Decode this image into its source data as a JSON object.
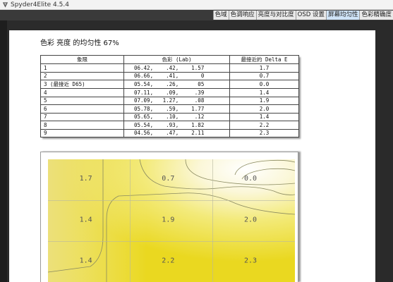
{
  "window": {
    "title": "Spyder4Elite 4.5.4"
  },
  "tabs": [
    {
      "label": "色域",
      "active": false
    },
    {
      "label": "色调响应",
      "active": false
    },
    {
      "label": "亮度与对比度",
      "active": false
    },
    {
      "label": "OSD 设置",
      "active": false
    },
    {
      "label": "屏幕均匀性",
      "active": true
    },
    {
      "label": "色彩精确度",
      "active": false
    }
  ],
  "report": {
    "heading": "色彩 亮度 的均匀性 67%",
    "table": {
      "headers": [
        "象限",
        "色彩 (Lab)",
        "最接近的 Delta E"
      ],
      "rows": [
        [
          "1",
          "06.42,    .42,    1.57",
          "1.7"
        ],
        [
          "2",
          "06.66,    .41,       0",
          "0.7"
        ],
        [
          "3 (最接近 D65)",
          "05.54,    .26,      05",
          "0.0"
        ],
        [
          "4",
          "07.11,    .09,     .39",
          "1.4"
        ],
        [
          "5",
          "07.09,   1.27,     .08",
          "1.9"
        ],
        [
          "6",
          "05.78,    .59,    1.77",
          "2.0"
        ],
        [
          "7",
          "05.65,    .10,     .12",
          "1.4"
        ],
        [
          "8",
          "05.54,    .93,    1.82",
          "2.2"
        ],
        [
          "9",
          "04.56,    .47,    2.11",
          "2.3"
        ]
      ]
    }
  },
  "chart_data": {
    "type": "heatmap",
    "grid": {
      "rows": 3,
      "cols": 3
    },
    "cell_labels": [
      [
        "1.7",
        "0.7",
        "0.0"
      ],
      [
        "1.4",
        "1.9",
        "2.0"
      ],
      [
        "1.4",
        "2.2",
        "2.3"
      ]
    ],
    "values": [
      [
        1.7,
        0.7,
        0.0
      ],
      [
        1.4,
        1.9,
        2.0
      ],
      [
        1.4,
        2.2,
        2.3
      ]
    ],
    "colors": {
      "low": "#ffffff",
      "high": "#e8d80c",
      "contour": "#8a8a60",
      "grid": "#b8b8a0"
    }
  }
}
